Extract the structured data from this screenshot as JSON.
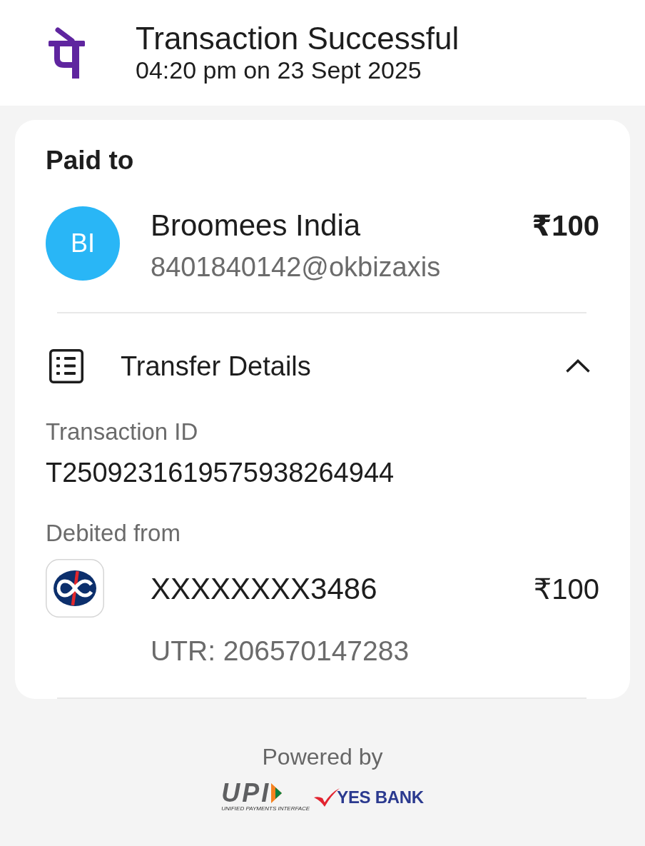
{
  "header": {
    "title": "Transaction Successful",
    "timestamp": "04:20 pm on 23 Sept 2025"
  },
  "paid_to": {
    "heading": "Paid to",
    "payee": {
      "initials": "BI",
      "name": "Broomees India",
      "upi_id": "8401840142@okbizaxis",
      "amount": "₹100"
    }
  },
  "transfer_details": {
    "title": "Transfer Details",
    "expanded": true,
    "transaction_id": {
      "label": "Transaction ID",
      "value": "T2509231619575938264944"
    },
    "debited_from": {
      "label": "Debited from",
      "account": "XXXXXXXX3486",
      "amount": "₹100",
      "utr": "UTR: 206570147283"
    }
  },
  "footer": {
    "powered_by": "Powered by",
    "partners": [
      {
        "kind": "upi",
        "name": "UPI",
        "tagline": "UNIFIED PAYMENTS INTERFACE"
      },
      {
        "kind": "bank",
        "name": "YES BANK"
      }
    ]
  }
}
